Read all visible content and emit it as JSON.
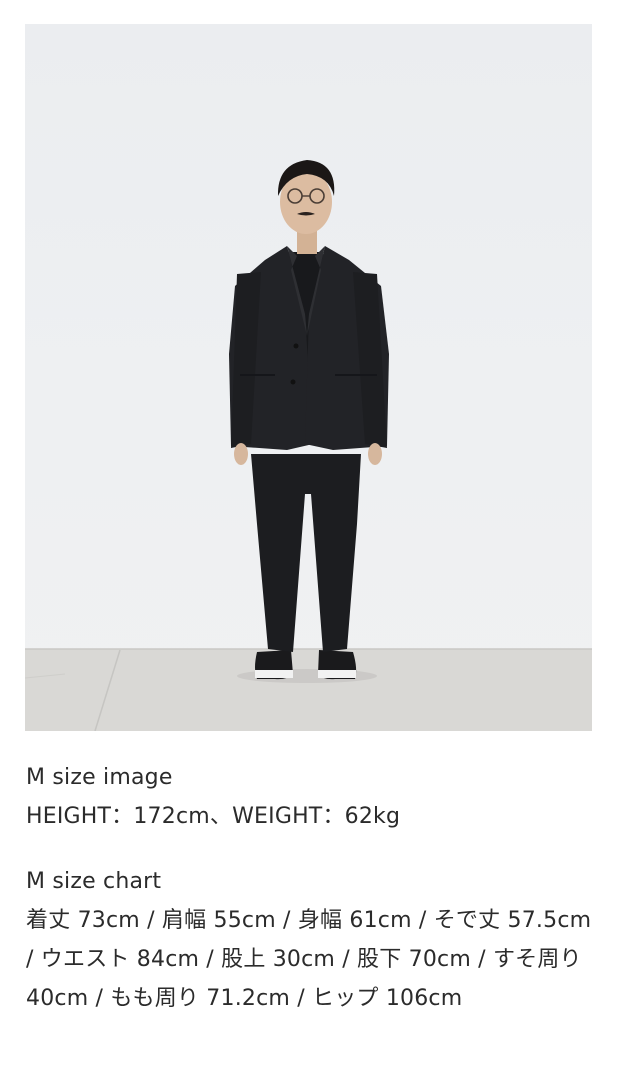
{
  "photo": {
    "subject": "person-standing-full-body",
    "colors": {
      "wall": "#eceef0",
      "floor": "#d9d8d5",
      "garment": "#1f2023"
    }
  },
  "image_info": {
    "title": "M size image",
    "measurements": "HEIGHT：172cm、WEIGHT：62kg"
  },
  "size_chart": {
    "title": "M size chart",
    "details": "着丈 73cm / 肩幅 55cm / 身幅 61cm / そで丈 57.5cm / ウエスト 84cm / 股上 30cm / 股下 70cm / すそ周り 40cm / もも周り 71.2cm / ヒップ 106cm"
  }
}
